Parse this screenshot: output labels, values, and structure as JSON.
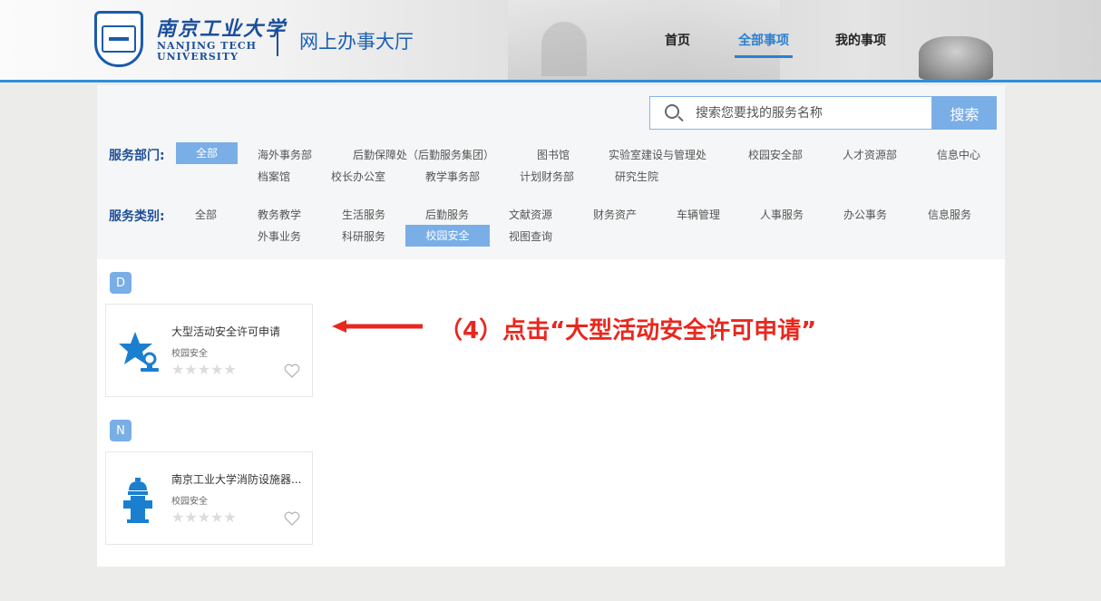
{
  "header": {
    "logo_cn": "南京工业大学",
    "logo_en_line1": "NANJING TECH",
    "logo_en_line2": "UNIVERSITY",
    "site_title": "网上办事大厅",
    "nav": [
      {
        "label": "首页",
        "active": false
      },
      {
        "label": "全部事项",
        "active": true
      },
      {
        "label": "我的事项",
        "active": false
      }
    ],
    "accent_color": "#2f8fd8"
  },
  "search": {
    "placeholder": "搜索您要找的服务名称",
    "button_label": "搜索"
  },
  "filters": {
    "department_label": "服务部门:",
    "departments": [
      "全部",
      "海外事务部",
      "后勤保障处（后勤服务集团）",
      "图书馆",
      "实验室建设与管理处",
      "校园安全部",
      "人才资源部",
      "信息中心",
      "档案馆",
      "校长办公室",
      "教学事务部",
      "计划财务部",
      "研究生院"
    ],
    "department_selected": "全部",
    "category_label": "服务类别:",
    "categories": [
      "全部",
      "教务教学",
      "生活服务",
      "后勤服务",
      "文献资源",
      "财务资产",
      "车辆管理",
      "人事服务",
      "办公事务",
      "信息服务",
      "外事业务",
      "科研服务",
      "校园安全",
      "视图查询"
    ],
    "category_selected": "校园安全",
    "selected_color": "#7aaee6"
  },
  "groups": [
    {
      "letter": "D",
      "items": [
        {
          "title": "大型活动安全许可申请",
          "category": "校园安全",
          "icon": "star-stamp-icon",
          "rating": 0
        }
      ]
    },
    {
      "letter": "N",
      "items": [
        {
          "title": "南京工业大学消防设施器...",
          "category": "校园安全",
          "icon": "fire-hydrant-icon",
          "rating": 0
        }
      ]
    }
  ],
  "annotation": {
    "text": "（4）点击“大型活动安全许可申请”",
    "color": "#e8281e"
  }
}
